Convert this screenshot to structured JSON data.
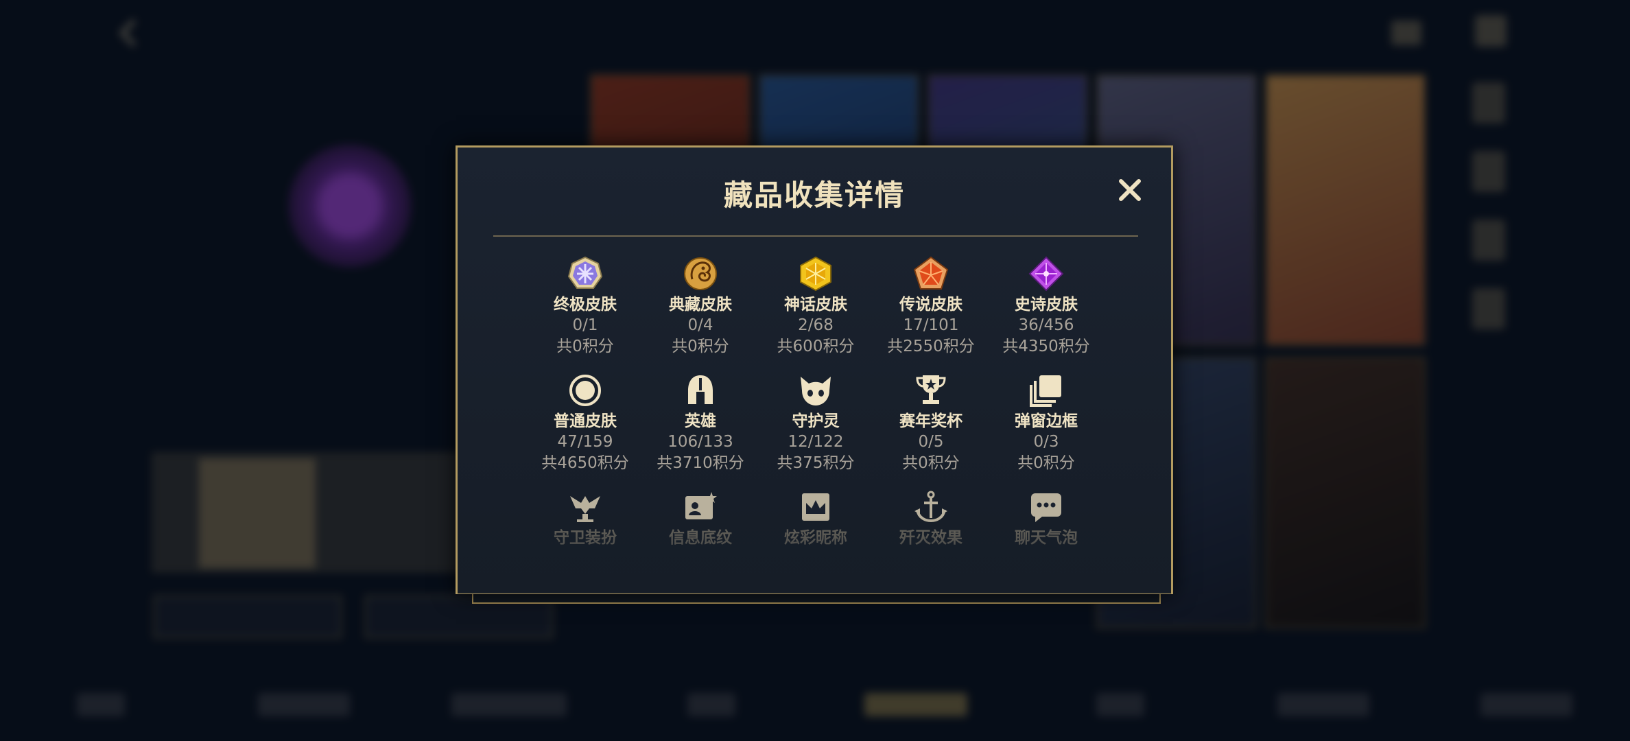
{
  "dialog": {
    "title": "藏品收集详情",
    "close_icon": "close-icon"
  },
  "collection": {
    "rows": [
      [
        {
          "name": "终极皮肤",
          "count": "0/1",
          "points": "共0积分",
          "icon": "ultimate-skin-icon"
        },
        {
          "name": "典藏皮肤",
          "count": "0/4",
          "points": "共0积分",
          "icon": "collector-skin-icon"
        },
        {
          "name": "神话皮肤",
          "count": "2/68",
          "points": "共600积分",
          "icon": "mythic-skin-icon"
        },
        {
          "name": "传说皮肤",
          "count": "17/101",
          "points": "共2550积分",
          "icon": "legendary-skin-icon"
        },
        {
          "name": "史诗皮肤",
          "count": "36/456",
          "points": "共4350积分",
          "icon": "epic-skin-icon"
        }
      ],
      [
        {
          "name": "普通皮肤",
          "count": "47/159",
          "points": "共4650积分",
          "icon": "common-skin-icon"
        },
        {
          "name": "英雄",
          "count": "106/133",
          "points": "共3710积分",
          "icon": "hero-helmet-icon"
        },
        {
          "name": "守护灵",
          "count": "12/122",
          "points": "共375积分",
          "icon": "guardian-spirit-icon"
        },
        {
          "name": "赛年奖杯",
          "count": "0/5",
          "points": "共0积分",
          "icon": "trophy-icon"
        },
        {
          "name": "弹窗边框",
          "count": "0/3",
          "points": "共0积分",
          "icon": "popup-frame-icon"
        }
      ],
      [
        {
          "name": "守卫装扮",
          "icon": "ward-skin-icon"
        },
        {
          "name": "信息底纹",
          "icon": "info-card-icon"
        },
        {
          "name": "炫彩昵称",
          "icon": "nickname-crown-icon"
        },
        {
          "name": "歼灭效果",
          "icon": "anchor-icon"
        },
        {
          "name": "聊天气泡",
          "icon": "chat-bubble-icon"
        }
      ]
    ]
  },
  "colors": {
    "accent_gold": "#b39b60",
    "title": "#f0e2bd",
    "muted_text": "#a9a39a",
    "modal_bg": "#1b2330"
  }
}
